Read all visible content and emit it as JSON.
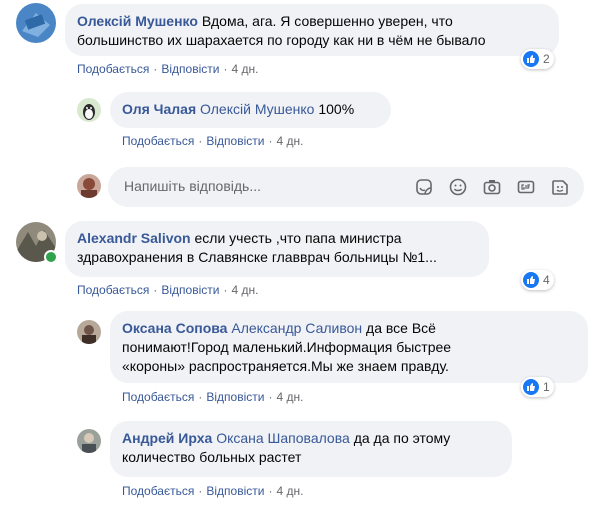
{
  "actions": {
    "like": "Подобається",
    "reply": "Відповісти",
    "sep": "·"
  },
  "comments": [
    {
      "author": "Олексій Мушенко",
      "line1": "Вдома, ага. Я совершенно уверен, что",
      "line2": "большинство их шарахается по городу как ни в чём не бывало",
      "time": "4 дн.",
      "reactions": "2"
    },
    {
      "author": "Оля Чалая",
      "mention": "Олексій Мушенко",
      "line1": "100%",
      "time": "4 дн."
    },
    {
      "author": "Alexandr Salivon",
      "line1": "если учесть ,что папа министра",
      "line2": "здравохранения в Славянске главврач больницы №1...",
      "time": "4 дн.",
      "reactions": "4"
    },
    {
      "author": "Оксана Сопова",
      "mention": "Александр Саливон",
      "line1": "да все Всё",
      "line2": "понимают!Город маленький.Информация быстрее",
      "line3": "«короны» распространяется.Мы же знаем правду.",
      "time": "4 дн.",
      "reactions": "1"
    },
    {
      "author": "Андрей Ирха",
      "mention": "Оксана Шаповалова",
      "line1": "да да по этому",
      "line2": "количество больных растет",
      "time": "4 дн."
    }
  ],
  "reply_box": {
    "placeholder": "Напишіть відповідь..."
  },
  "colors": {
    "link": "#385898",
    "bubble": "#f0f2f5",
    "like": "#1877f2",
    "online": "#31a24c"
  }
}
